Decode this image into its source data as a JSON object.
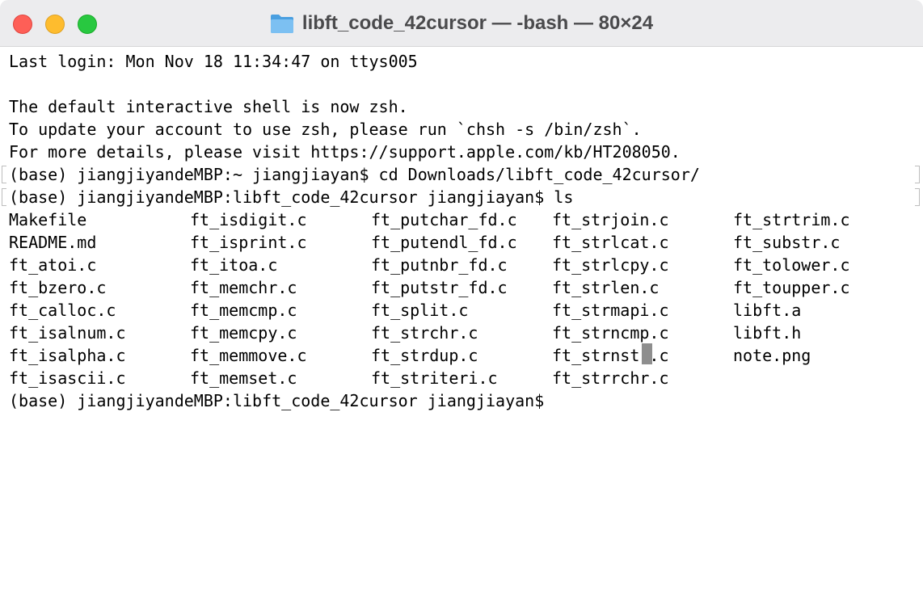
{
  "window": {
    "title": "libft_code_42cursor — -bash — 80×24",
    "folder_icon": "folder-icon",
    "traffic_lights": {
      "close": "#fe5f57",
      "minimize": "#febc2e",
      "zoom": "#28c840"
    }
  },
  "terminal": {
    "last_login": "Last login: Mon Nov 18 11:34:47 on ttys005",
    "zsh_notice": "The default interactive shell is now zsh.",
    "update_hint": "To update your account to use zsh, please run `chsh -s /bin/zsh`.",
    "details_hint": "For more details, please visit https://support.apple.com/kb/HT208050.",
    "cmd_cd": "(base) jiangjiyandeMBP:~ jiangjiayan$ cd Downloads/libft_code_42cursor/",
    "cmd_ls": "(base) jiangjiyandeMBP:libft_code_42cursor jiangjiayan$ ls",
    "ls_output": [
      [
        "Makefile",
        "ft_isdigit.c",
        "ft_putchar_fd.c",
        "ft_strjoin.c",
        "ft_strtrim.c"
      ],
      [
        "README.md",
        "ft_isprint.c",
        "ft_putendl_fd.c",
        "ft_strlcat.c",
        "ft_substr.c"
      ],
      [
        "ft_atoi.c",
        "ft_itoa.c",
        "ft_putnbr_fd.c",
        "ft_strlcpy.c",
        "ft_tolower.c"
      ],
      [
        "ft_bzero.c",
        "ft_memchr.c",
        "ft_putstr_fd.c",
        "ft_strlen.c",
        "ft_toupper.c"
      ],
      [
        "ft_calloc.c",
        "ft_memcmp.c",
        "ft_split.c",
        "ft_strmapi.c",
        "libft.a"
      ],
      [
        "ft_isalnum.c",
        "ft_memcpy.c",
        "ft_strchr.c",
        "ft_strncmp.c",
        "libft.h"
      ],
      [
        "ft_isalpha.c",
        "ft_memmove.c",
        "ft_strdup.c",
        "ft_strnstr.c",
        "note.png"
      ],
      [
        "ft_isascii.c",
        "ft_memset.c",
        "ft_striteri.c",
        "ft_strrchr.c",
        ""
      ]
    ],
    "final_prompt": "(base) jiangjiyandeMBP:libft_code_42cursor jiangjiayan$ "
  }
}
